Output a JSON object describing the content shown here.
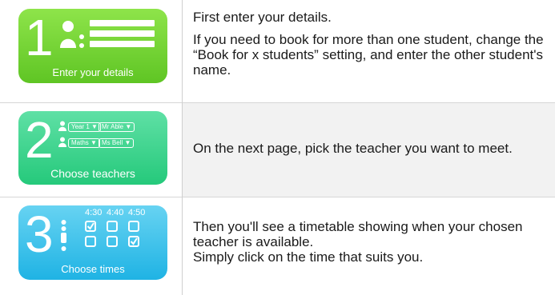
{
  "steps": [
    {
      "number": "1",
      "caption": "Enter your details",
      "text": [
        "First enter your details.",
        "If you need to book for more than one student, change the “Book for x students” setting, and enter the other student's name."
      ]
    },
    {
      "number": "2",
      "caption": "Choose teachers",
      "pills": [
        "Year 1 ▼",
        "Mr Able ▼",
        "Maths ▼",
        "Ms Bell ▼"
      ],
      "text": [
        "On the next page, pick the teacher you want to meet."
      ]
    },
    {
      "number": "3",
      "caption": "Choose times",
      "times": [
        "4:30",
        "4:40",
        "4:50"
      ],
      "text": [
        "Then you'll see a timetable showing when your chosen teacher is available.",
        "Simply click on the time that suits you."
      ]
    }
  ],
  "colors": {
    "step1": "#6fd12f",
    "step2": "#34d189",
    "step3": "#32bbe8",
    "divider": "#d6d6d6",
    "row_alt": "#f2f2f2"
  },
  "icons": {
    "step1": "person-form-icon",
    "step2": "person-dropdown-icon",
    "step3": "checkbox-grid-icon"
  }
}
